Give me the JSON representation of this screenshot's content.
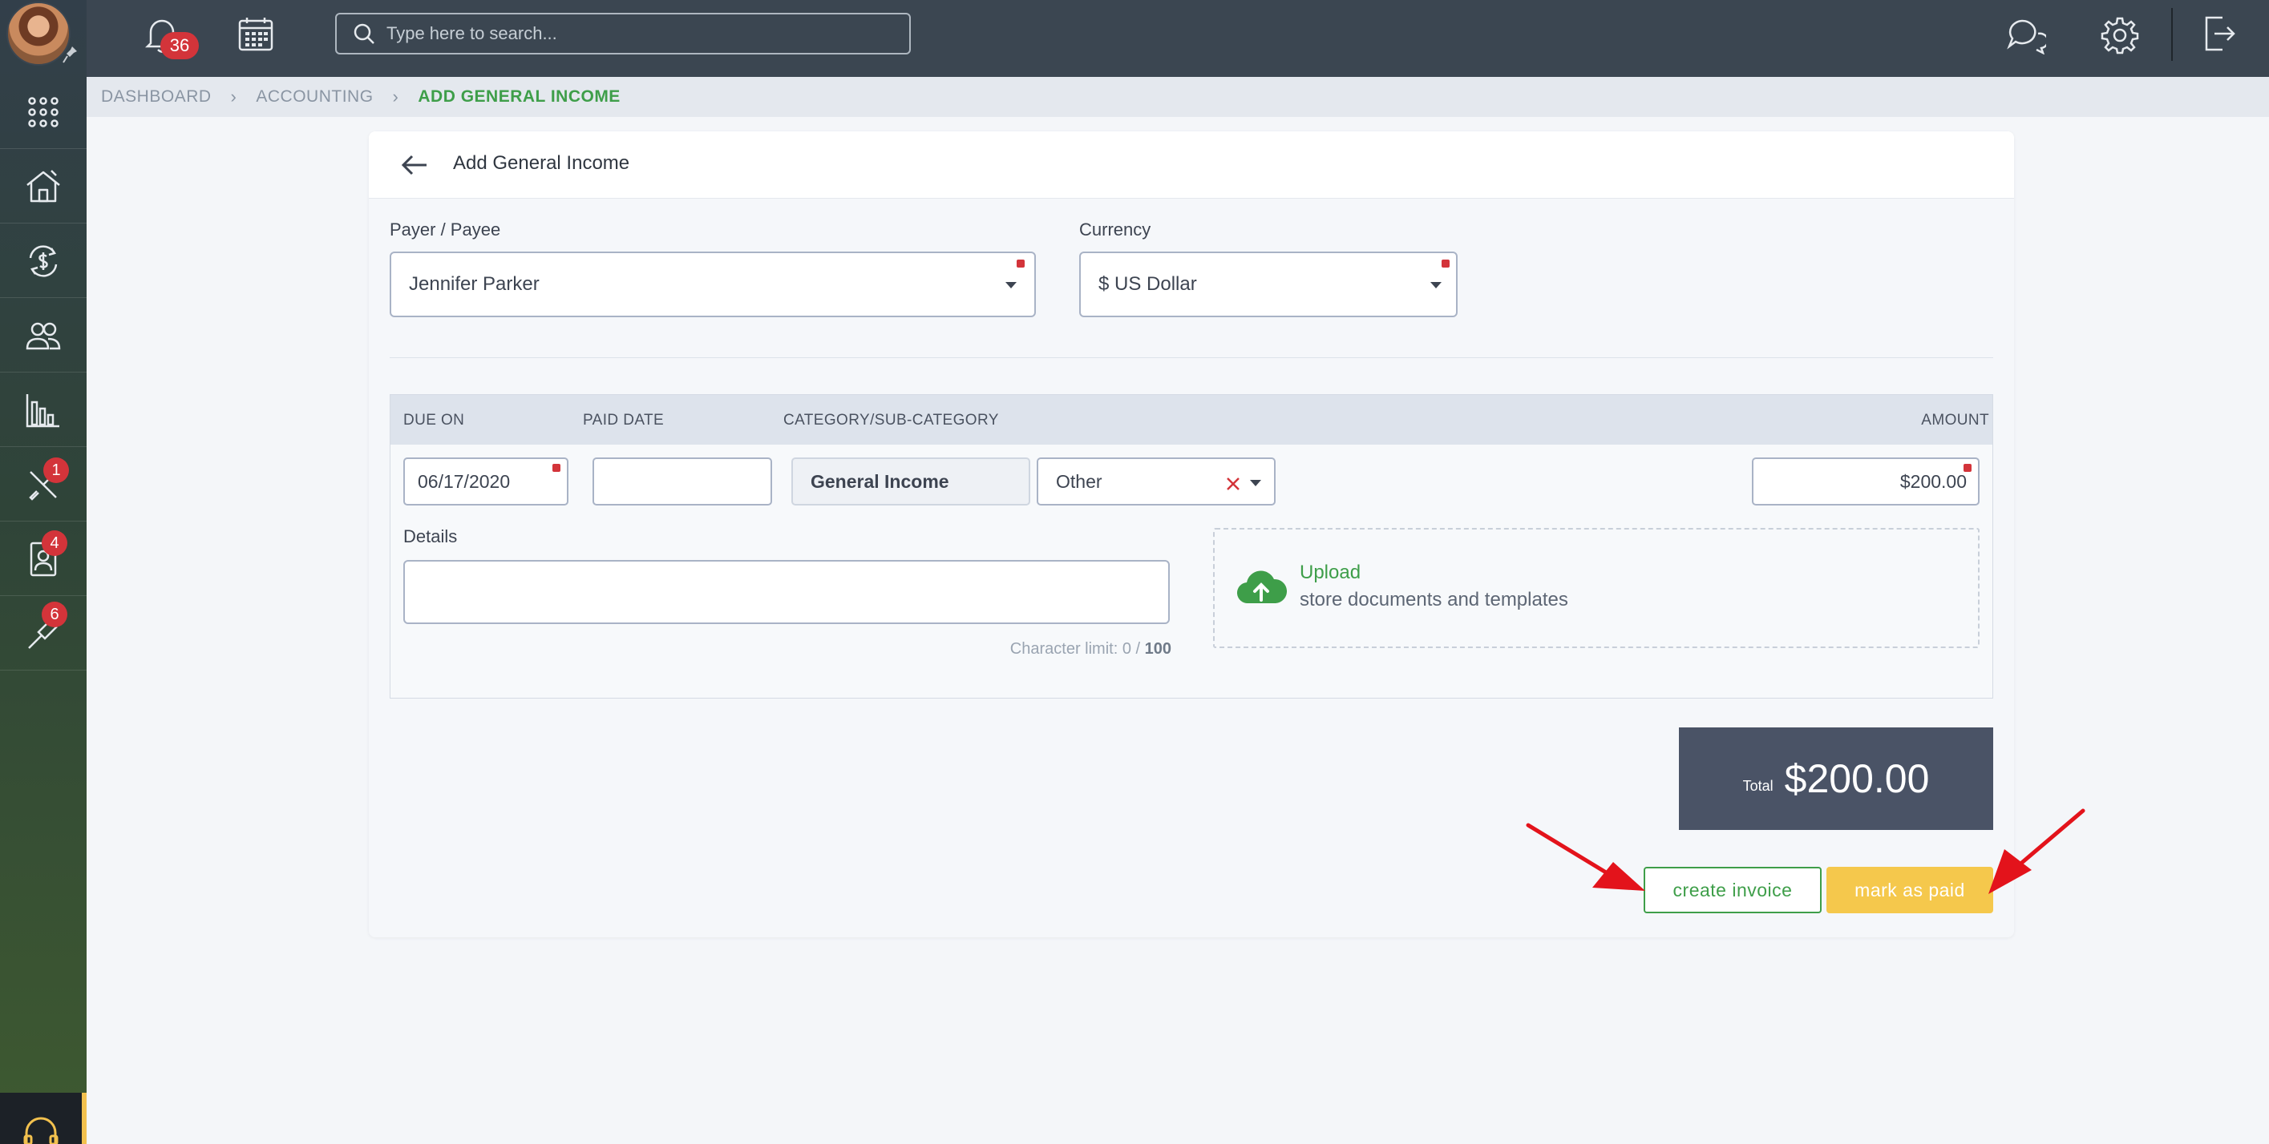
{
  "topbar": {
    "notifications_count": "36",
    "search_placeholder": "Type here to search..."
  },
  "sidebar": {
    "items": [
      {
        "icon": "apps-grid-icon"
      },
      {
        "icon": "house-icon"
      },
      {
        "icon": "dollar-cycle-icon"
      },
      {
        "icon": "people-icon"
      },
      {
        "icon": "bar-chart-icon"
      },
      {
        "icon": "tools-icon",
        "badge": "1"
      },
      {
        "icon": "contact-card-icon",
        "badge": "4"
      },
      {
        "icon": "screwdriver-icon",
        "badge": "6"
      }
    ]
  },
  "breadcrumb": [
    "DASHBOARD",
    "ACCOUNTING",
    "ADD GENERAL INCOME"
  ],
  "form": {
    "title": "Add General Income",
    "payer_label": "Payer / Payee",
    "payer_value": "Jennifer Parker",
    "currency_label": "Currency",
    "currency_value": "$ US Dollar"
  },
  "table": {
    "headers": {
      "due_on": "DUE ON",
      "paid_date": "PAID DATE",
      "category": "CATEGORY/SUB-CATEGORY",
      "amount": "AMOUNT"
    },
    "row": {
      "due_on": "06/17/2020",
      "paid_date": "",
      "category": "General Income",
      "subcategory": "Other",
      "amount": "$200.00"
    },
    "details_label": "Details",
    "details_value": "",
    "char_limit_prefix": "Character limit: 0 / ",
    "char_limit_max": "100",
    "upload_title": "Upload",
    "upload_subtitle": "store documents and templates"
  },
  "total": {
    "label": "Total",
    "value": "$200.00"
  },
  "actions": {
    "create_invoice": "create invoice",
    "mark_as_paid": "mark as paid"
  },
  "colors": {
    "accent_green": "#3e9e49",
    "accent_yellow": "#f5c84c",
    "badge_red": "#d3343a",
    "annotation_red": "#e3131b"
  }
}
